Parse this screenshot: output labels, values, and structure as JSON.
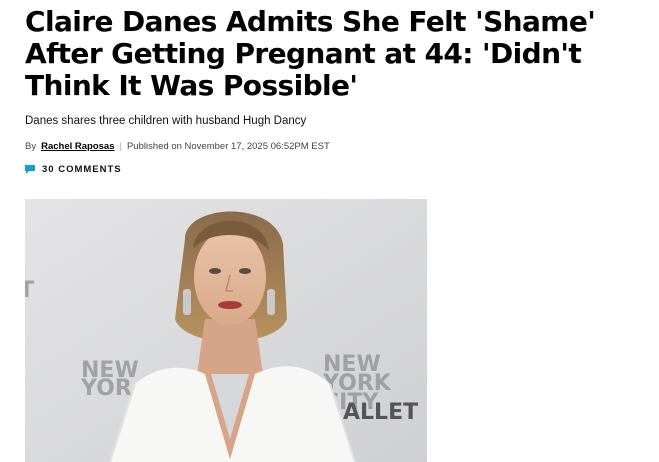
{
  "article": {
    "headline": "Claire Danes Admits She Felt 'Shame' After Getting Pregnant at 44: 'Didn't Think It Was Possible'",
    "dek": "Danes shares three children with husband Hugh Dancy",
    "byline": {
      "by_label": "By",
      "author": "Rachel Raposas",
      "separator": "|",
      "published": "Published on November 17, 2025 06:52PM EST"
    },
    "comments": {
      "icon": "comment-bubble-icon",
      "label": "30 COMMENTS"
    },
    "image": {
      "backdrop_text_left_1": "NEW",
      "backdrop_text_left_2": "YOR",
      "backdrop_text_right_1": "NEW",
      "backdrop_text_right_2": "YORK",
      "backdrop_text_right_3": "CITY",
      "backdrop_text_right_4": "ALLET",
      "backdrop_text_edge_left": "T",
      "backdrop_text_edge_right": "T"
    }
  },
  "colors": {
    "comment_icon": "#1a9ad6",
    "backdrop": "#dcdcdc"
  }
}
